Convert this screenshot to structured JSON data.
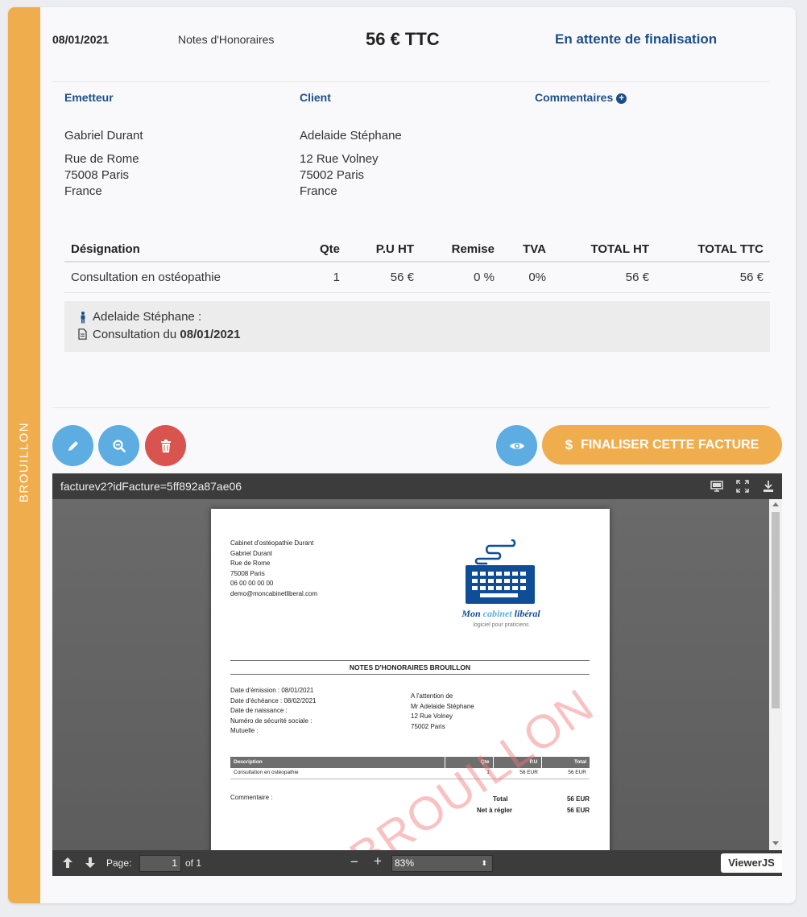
{
  "sidebar": {
    "status_label": "BROUILLON"
  },
  "header": {
    "date": "08/01/2021",
    "doc_type": "Notes d'Honoraires",
    "amount": "56 € TTC",
    "status": "En attente de finalisation"
  },
  "emitter": {
    "heading": "Emetteur",
    "name": "Gabriel Durant",
    "street": "Rue de Rome",
    "city": "75008 Paris",
    "country": "France"
  },
  "client": {
    "heading": "Client",
    "name": "Adelaide Stéphane",
    "street": "12 Rue Volney",
    "city": "75002 Paris",
    "country": "France"
  },
  "comments": {
    "heading": "Commentaires"
  },
  "items_table": {
    "headers": [
      "Désignation",
      "Qte",
      "P.U HT",
      "Remise",
      "TVA",
      "TOTAL HT",
      "TOTAL TTC"
    ],
    "rows": [
      [
        "Consultation en ostéopathie",
        "1",
        "56 €",
        "0 %",
        "0%",
        "56 €",
        "56 €"
      ]
    ]
  },
  "detail": {
    "patient": "Adelaide Stéphane :",
    "consult_prefix": "Consultation du",
    "consult_date": "08/01/2021"
  },
  "actions": {
    "finalize_label": "FINALISER CETTE FACTURE"
  },
  "colors": {
    "brand_orange": "#f0ad4e",
    "action_blue": "#5dade2",
    "danger_red": "#d9534f",
    "heading_blue": "#1c4f8a"
  },
  "viewer": {
    "title": "facturev2?idFacture=5ff892a87ae06",
    "page_label": "Page:",
    "page_value": "1",
    "page_total": "of 1",
    "zoom": "83%",
    "brand": "ViewerJS"
  },
  "pdf": {
    "sender_lines": [
      "Cabinet d'ostéopathie Durant",
      "Gabriel Durant",
      "Rue de Rome",
      "75008 Paris",
      "06 00 00 00 00",
      "demo@moncabinetliberal.com"
    ],
    "logo_name_a": "Mon ",
    "logo_name_b": "cabinet",
    "logo_name_c": " libéral",
    "logo_tagline": "logiciel pour praticiens",
    "title": "NOTES D'HONORAIRES BROUILLON",
    "info_lines": [
      "Date d'émission : 08/01/2021",
      "Date d'échéance : 08/02/2021",
      "Date de naissance :",
      "Numéro de sécurité sociale :",
      "Mutuelle :"
    ],
    "recipient_lines": [
      "A l'attention de",
      "Mr Adelaide Stéphane",
      "12 Rue Volney",
      "75002 Paris"
    ],
    "table_headers": [
      "Description",
      "Qte",
      "P.U",
      "Total"
    ],
    "table_row": [
      "Consultation en ostéopathie",
      "1",
      "56 EUR",
      "56 EUR"
    ],
    "comment_label": "Commentaire :",
    "total_label": "Total",
    "total_value": "56 EUR",
    "net_label": "Net à régler",
    "net_value": "56 EUR",
    "watermark": "BROUILLON"
  }
}
